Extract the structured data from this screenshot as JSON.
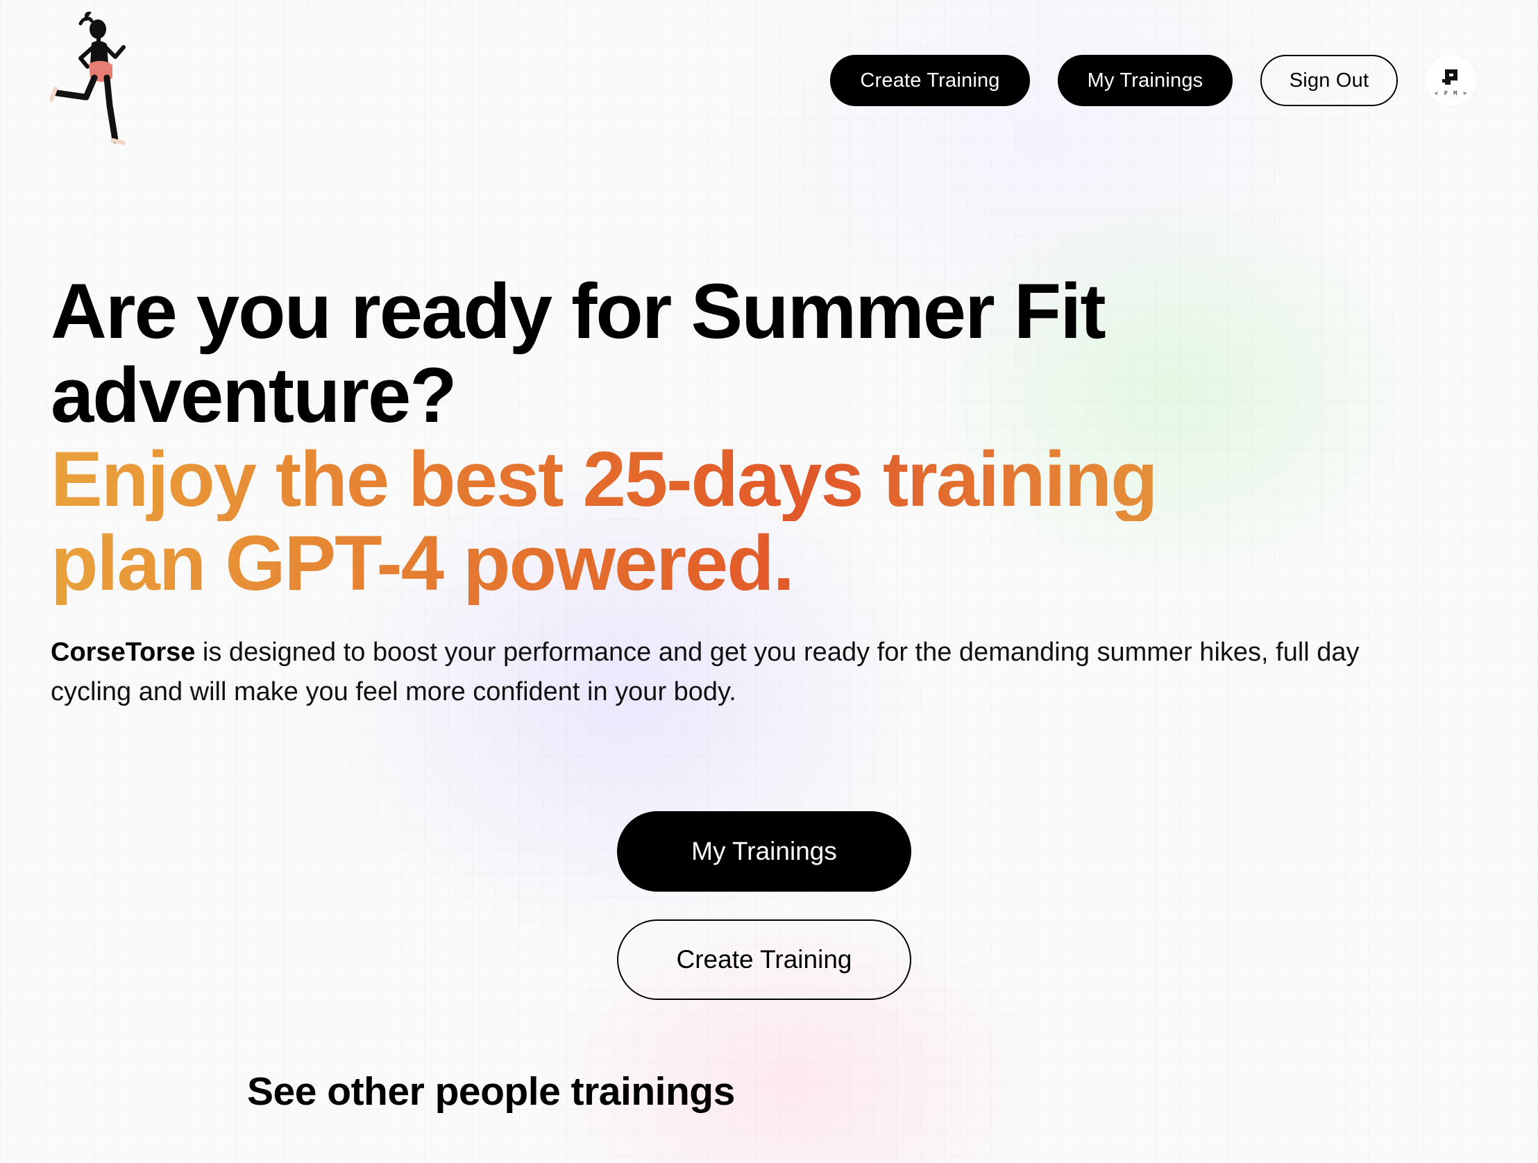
{
  "header": {
    "nav": {
      "create_training": "Create Training",
      "my_trainings": "My Trainings",
      "sign_out": "Sign Out"
    },
    "avatar": {
      "mark": "P",
      "text": "< P M >",
      "icon": "pm-logo-icon"
    },
    "logo_icon": "running-woman-icon"
  },
  "hero": {
    "title_line1": "Are you ready for Summer Fit",
    "title_line2": "adventure?",
    "subtitle_line1": "Enjoy the best 25-days training",
    "subtitle_line2": "plan GPT-4 powered.",
    "brand": "CorseTorse",
    "description": " is designed to boost your performance and get you ready for the demanding summer hikes, full day cycling and will make you feel more confident in your body."
  },
  "cta": {
    "my_trainings": "My Trainings",
    "create_training": "Create Training"
  },
  "others": {
    "title": "See other people trainings"
  },
  "colors": {
    "primary": "#000000",
    "accent_orange_start": "#e9a23b",
    "accent_orange_mid": "#e2632a",
    "accent_orange_end": "#e7b344",
    "shorts": "#e67e73"
  }
}
